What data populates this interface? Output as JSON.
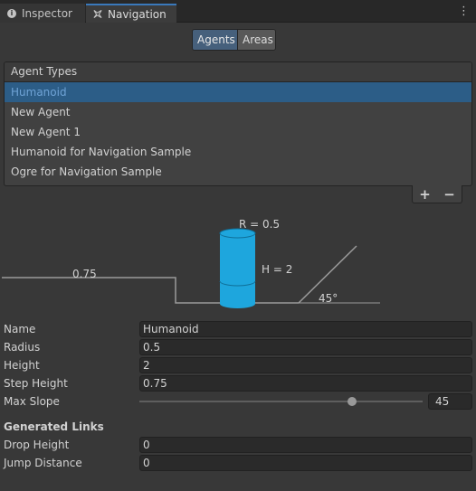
{
  "tabs": [
    {
      "label": "Inspector",
      "icon": "info-icon",
      "active": false
    },
    {
      "label": "Navigation",
      "icon": "navmesh-icon",
      "active": true
    }
  ],
  "segmented": {
    "agents": "Agents",
    "areas": "Areas",
    "selected": "Agents"
  },
  "agent_list": {
    "header": "Agent Types",
    "items": [
      "Humanoid",
      "New Agent",
      "New Agent 1",
      "Humanoid for Navigation Sample",
      "Ogre for Navigation Sample"
    ],
    "selected_index": 0,
    "add": "+",
    "remove": "−"
  },
  "diagram": {
    "radius_label": "R = 0.5",
    "height_label": "H = 2",
    "step_label": "0.75",
    "slope_label": "45°"
  },
  "fields": {
    "name": {
      "label": "Name",
      "value": "Humanoid"
    },
    "radius": {
      "label": "Radius",
      "value": "0.5"
    },
    "height": {
      "label": "Height",
      "value": "2"
    },
    "step_height": {
      "label": "Step Height",
      "value": "0.75"
    },
    "max_slope": {
      "label": "Max Slope",
      "value": "45",
      "min": 0,
      "max": 60
    }
  },
  "generated_links": {
    "title": "Generated Links",
    "drop_height": {
      "label": "Drop Height",
      "value": "0"
    },
    "jump_distance": {
      "label": "Jump Distance",
      "value": "0"
    }
  },
  "colors": {
    "background": "#383838",
    "selection": "#2c5d87",
    "accent_tab": "#3a79bb",
    "agent_cylinder": "#1ea6dd"
  }
}
